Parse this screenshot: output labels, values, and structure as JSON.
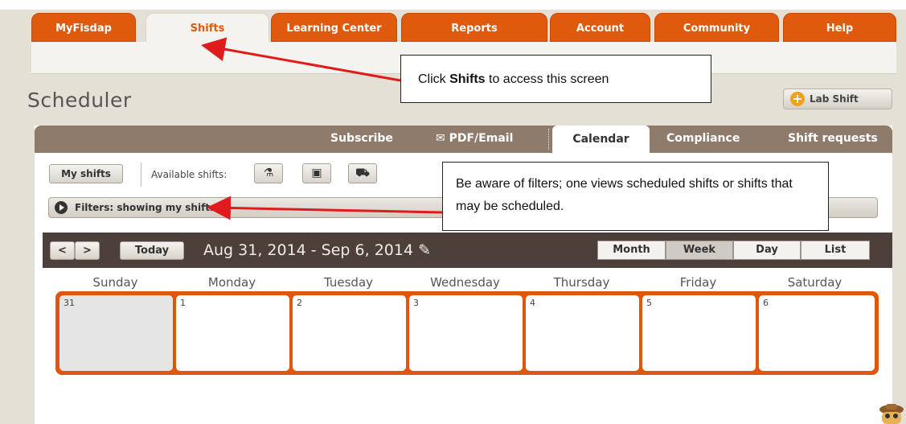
{
  "nav": {
    "tabs": [
      {
        "label": "MyFisdap"
      },
      {
        "label": "Shifts"
      },
      {
        "label": "Learning Center"
      },
      {
        "label": "Reports"
      },
      {
        "label": "Account"
      },
      {
        "label": "Community"
      },
      {
        "label": "Help"
      }
    ]
  },
  "page": {
    "title": "Scheduler",
    "lab_shift_label": "Lab Shift"
  },
  "panel_tabs": {
    "subscribe": "Subscribe",
    "pdf_email": "PDF/Email",
    "calendar": "Calendar",
    "compliance": "Compliance",
    "shift_requests": "Shift requests"
  },
  "toolbar": {
    "my_shifts": "My shifts",
    "available_label": "Available shifts:",
    "icons": [
      "flask-icon",
      "disk-icon",
      "ambulance-icon"
    ]
  },
  "filters": {
    "text": "Filters: showing my shifts"
  },
  "calendar": {
    "prev": "<",
    "next": ">",
    "today": "Today",
    "range": "Aug 31, 2014 - Sep 6, 2014",
    "views": [
      "Month",
      "Week",
      "Day",
      "List"
    ],
    "active_view": "Week",
    "days": [
      "Sunday",
      "Monday",
      "Tuesday",
      "Wednesday",
      "Thursday",
      "Friday",
      "Saturday"
    ],
    "dates": [
      "31",
      "1",
      "2",
      "3",
      "4",
      "5",
      "6"
    ]
  },
  "annotations": {
    "callout1_pre": "Click ",
    "callout1_bold": "Shifts",
    "callout1_post": " to access this screen",
    "callout2": "Be aware of filters; one views scheduled shifts or shifts that may be scheduled."
  },
  "colors": {
    "accent": "#e05a0d",
    "panel_header": "#8f7b6b",
    "calendar_header": "#4d3f3a"
  }
}
